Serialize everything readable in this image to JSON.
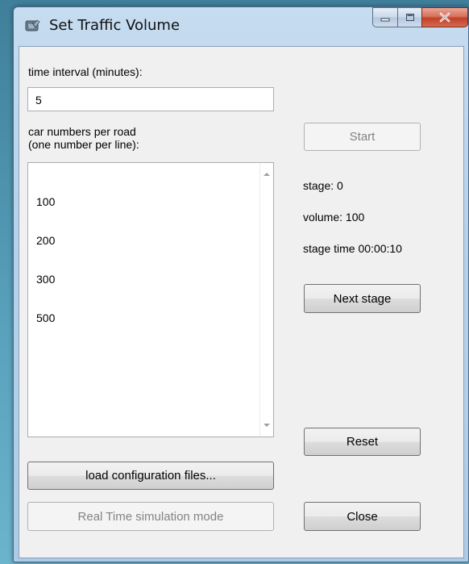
{
  "window": {
    "title": "Set Traffic Volume",
    "icon": "traffic-app-icon"
  },
  "form": {
    "interval_label": "time interval (minutes):",
    "interval_value": "5",
    "cars_label_line1": "car numbers per road",
    "cars_label_line2": "(one number per line):",
    "car_numbers": [
      "100",
      "200",
      "300",
      "500"
    ]
  },
  "buttons": {
    "start": "Start",
    "next_stage": "Next stage",
    "reset": "Reset",
    "load_config": "load configuration files...",
    "real_time": "Real Time simulation mode",
    "close": "Close"
  },
  "status": {
    "stage": "stage: 0",
    "volume": "volume: 100",
    "stage_time": "stage time 00:00:10"
  },
  "colors": {
    "desktop": "#5aa2bd",
    "client_bg": "#f0f0f0",
    "close_button": "#c1402a"
  }
}
